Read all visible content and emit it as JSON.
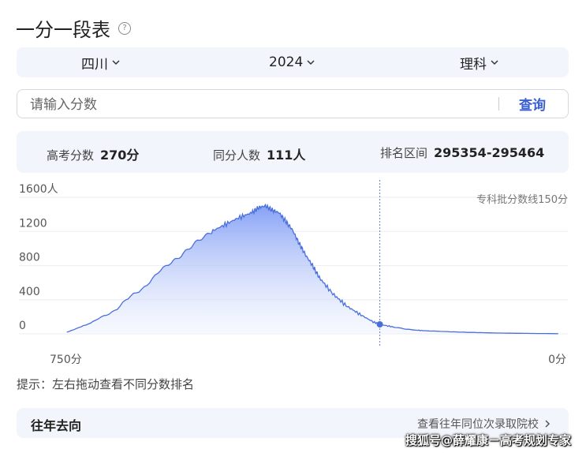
{
  "title": "一分一段表",
  "filters": {
    "province": "四川",
    "year": "2024",
    "subject": "理科"
  },
  "search": {
    "placeholder": "请输入分数",
    "value": "",
    "button_label": "查询"
  },
  "stats": {
    "score_label": "高考分数",
    "score_value": "270分",
    "same_label": "同分人数",
    "same_value": "111人",
    "rank_label": "排名区间",
    "rank_value": "295354-295464"
  },
  "chart_data": {
    "type": "area",
    "title": "",
    "y_ticks": [
      "1600人",
      "1200",
      "800",
      "400",
      "0"
    ],
    "ylim": [
      0,
      1600
    ],
    "xlim": [
      750,
      0
    ],
    "x_start_label": "750分",
    "x_end_label": "0分",
    "x_reversed": true,
    "grid": true,
    "marker": {
      "score": 270,
      "count": 111
    },
    "annotation": "专科批分数线150分",
    "line_color": "#4a6fdc",
    "fill_color": "#7f9cf5",
    "series": [
      {
        "x": [
          735,
          700,
          660,
          620,
          580,
          550,
          520,
          500,
          480,
          460,
          450,
          440,
          430,
          420,
          410,
          400,
          390,
          380,
          370,
          360,
          340,
          320,
          300,
          280,
          270,
          250,
          220,
          200,
          150,
          100,
          50,
          5
        ],
        "values": [
          20,
          120,
          300,
          560,
          840,
          1020,
          1200,
          1280,
          1360,
          1420,
          1480,
          1500,
          1450,
          1420,
          1320,
          1220,
          1060,
          920,
          800,
          660,
          470,
          330,
          230,
          140,
          111,
          80,
          45,
          35,
          20,
          10,
          5,
          2
        ]
      }
    ]
  },
  "hint": "提示：左右拖动查看不同分数排名",
  "past": {
    "title": "往年去向",
    "link": "查看往年同位次录取院校"
  },
  "watermark": "搜狐号@薛耀康－高考规划专家",
  "colors": {
    "accent": "#3a5fd0",
    "panel": "#f2f5fb"
  }
}
